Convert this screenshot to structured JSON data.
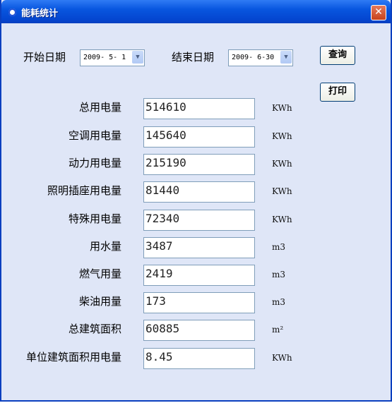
{
  "window": {
    "title": "能耗统计",
    "close": "✕"
  },
  "query": {
    "start_label": "开始日期",
    "start_value": "2009- 5- 1",
    "end_label": "结束日期",
    "end_value": "2009- 6-30",
    "query_button": "查询",
    "print_button": "打印"
  },
  "rows": [
    {
      "label": "总用电量",
      "value": "514610",
      "unit": "KWh"
    },
    {
      "label": "空调用电量",
      "value": "145640",
      "unit": "KWh"
    },
    {
      "label": "动力用电量",
      "value": "215190",
      "unit": "KWh"
    },
    {
      "label": "照明插座用电量",
      "value": "81440",
      "unit": "KWh"
    },
    {
      "label": "特殊用电量",
      "value": "72340",
      "unit": "KWh"
    },
    {
      "label": "用水量",
      "value": "3487",
      "unit": "m3"
    },
    {
      "label": "燃气用量",
      "value": "2419",
      "unit": "m3"
    },
    {
      "label": "柴油用量",
      "value": "173",
      "unit": "m3"
    },
    {
      "label": "总建筑面积",
      "value": "60885",
      "unit": "m²"
    },
    {
      "label": "单位建筑面积用电量",
      "value": "8.45",
      "unit": "KWh"
    }
  ]
}
